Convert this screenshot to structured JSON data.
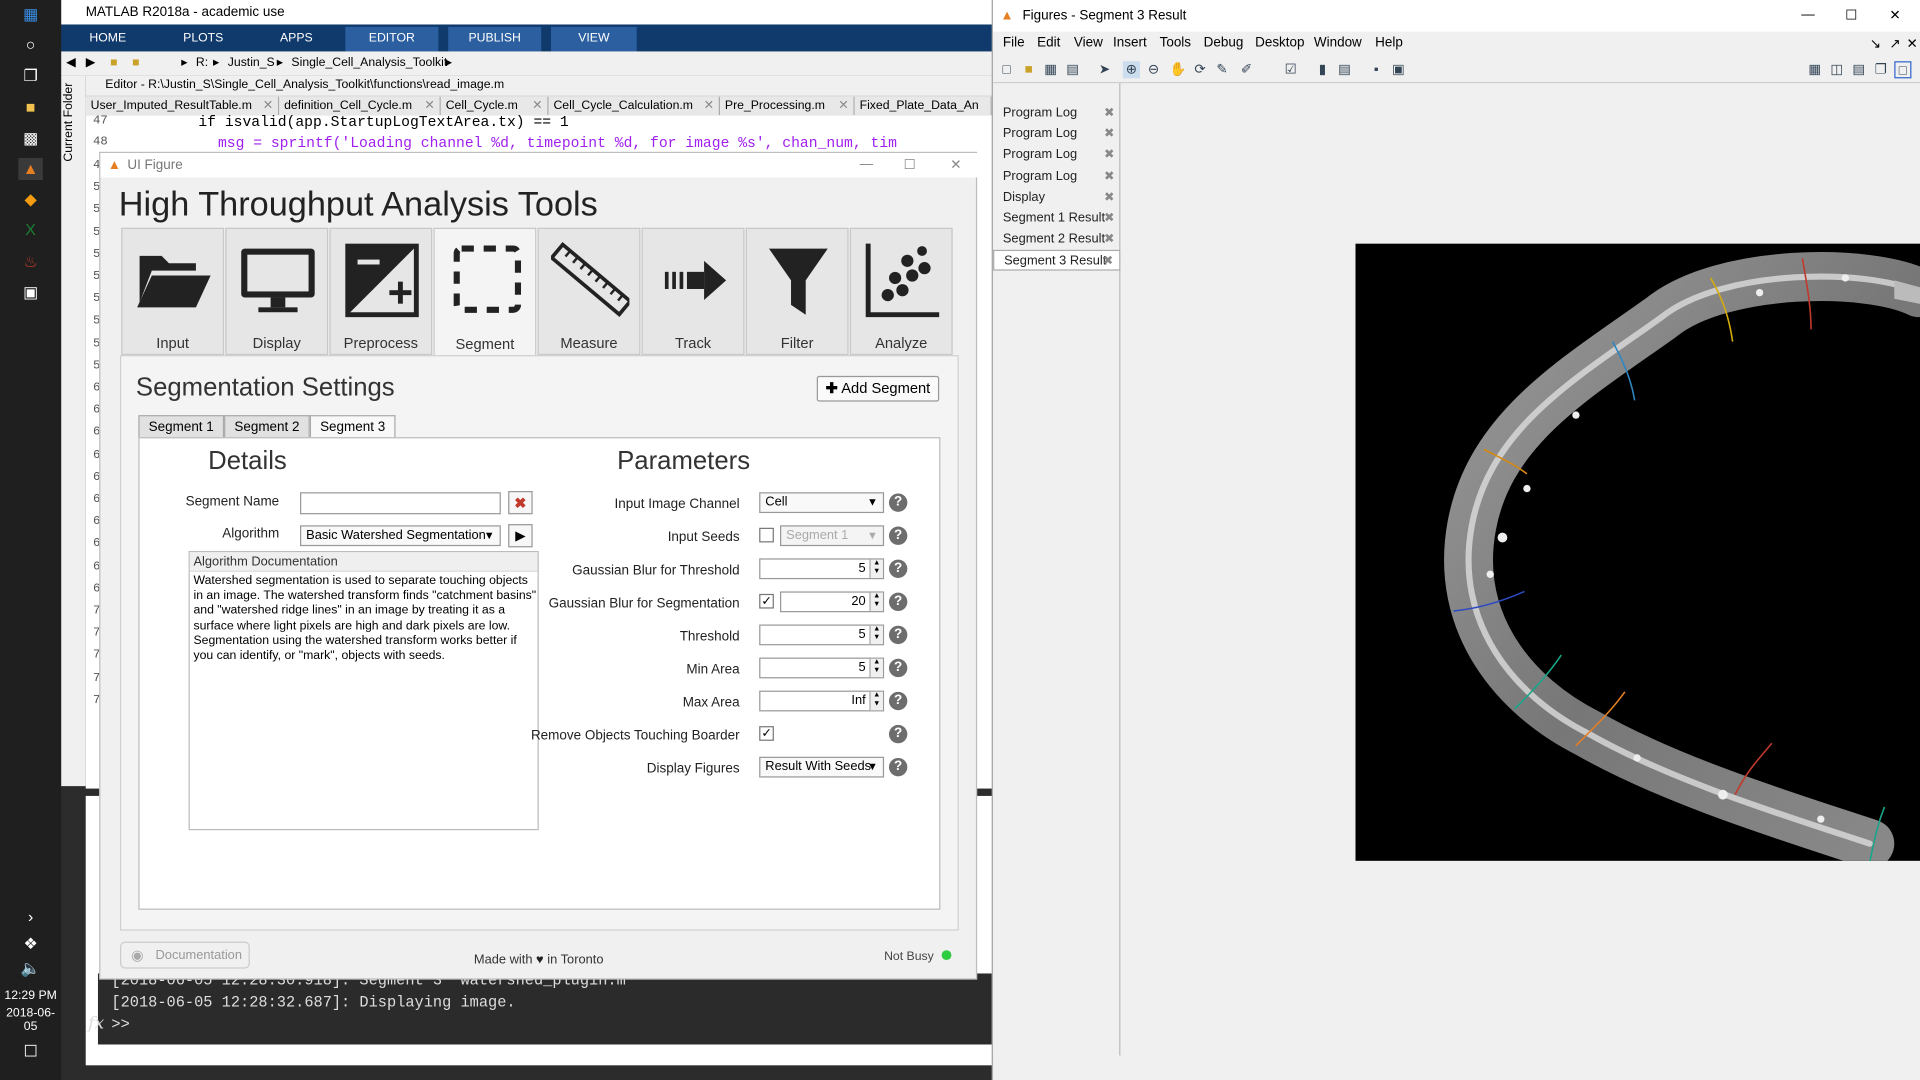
{
  "colors": {
    "accent": "#2b5fa0",
    "ribbon": "#0f3a6b",
    "busy": "#2ecc40",
    "panel": "#f0f0f0"
  },
  "matlab": {
    "title": "MATLAB R2018a - academic use",
    "tabs": [
      "HOME",
      "PLOTS",
      "APPS",
      "EDITOR",
      "PUBLISH",
      "VIEW"
    ],
    "path": [
      "R:",
      "Justin_S",
      "Single_Cell_Analysis_Toolkit"
    ],
    "current_folder_label": "Current Folder",
    "editor_title": "Editor - R:\\Justin_S\\Single_Cell_Analysis_Toolkit\\functions\\read_image.m",
    "file_tabs": [
      "User_Imputed_ResultTable.m",
      "definition_Cell_Cycle.m",
      "Cell_Cycle.m",
      "Cell_Cycle_Calculation.m",
      "Pre_Processing.m",
      "Fixed_Plate_Data_An"
    ],
    "code_lines": [
      {
        "num": "47",
        "text": "if isvalid(app.StartupLogTextArea.tx) == 1"
      },
      {
        "num": "48",
        "text": "msg = sprintf('Loading channel %d, timepoint %d, for image %s', chan_num, tim"
      }
    ],
    "line_numbers": [
      "4",
      "5",
      "5",
      "5",
      "5",
      "5",
      "5",
      "5",
      "5",
      "5",
      "6",
      "6",
      "6",
      "6",
      "6",
      "6",
      "6",
      "6",
      "6",
      "6",
      "7",
      "7",
      "7",
      "7",
      "7"
    ],
    "console_lines": [
      "[2018-06-05 12:28:30.918]: Segment 3 'watershed_plugin.m'",
      "[2018-06-05 12:28:32.687]: Displaying image."
    ],
    "prompt": ">>",
    "fx": "fx"
  },
  "taskbar": {
    "time": "12:29 PM",
    "date": "2018-06-05"
  },
  "ui": {
    "window_title": "UI Figure",
    "app_title": "High Throughput Analysis Tools",
    "tools": [
      "Input",
      "Display",
      "Preprocess",
      "Segment",
      "Measure",
      "Track",
      "Filter",
      "Analyze"
    ],
    "active_tool": "Segment",
    "seg_title": "Segmentation Settings",
    "add_segment": "Add Segment",
    "seg_tabs": [
      "Segment 1",
      "Segment 2",
      "Segment 3"
    ],
    "details": {
      "heading": "Details",
      "segment_name_label": "Segment Name",
      "segment_name_value": "",
      "algorithm_label": "Algorithm",
      "algorithm_value": "Basic Watershed Segmentation",
      "doc_heading": "Algorithm Documentation",
      "doc_text": "Watershed segmentation is used to separate touching objects in an image. The watershed transform finds \"catchment basins\" and \"watershed ridge lines\" in an image by treating it as a surface where light pixels are high and dark pixels are low. Segmentation using the watershed transform works better if you can identify, or \"mark\", objects with seeds."
    },
    "parameters": {
      "heading": "Parameters",
      "items": [
        {
          "label": "Input Image Channel",
          "kind": "select",
          "value": "Cell"
        },
        {
          "label": "Input Seeds",
          "kind": "checkselect",
          "value": "Segment 1",
          "checked": false
        },
        {
          "label": "Gaussian Blur for Threshold",
          "kind": "number",
          "value": "5"
        },
        {
          "label": "Gaussian Blur for Segmentation",
          "kind": "checknumber",
          "value": "20",
          "checked": true
        },
        {
          "label": "Threshold",
          "kind": "number",
          "value": "5"
        },
        {
          "label": "Min Area",
          "kind": "number",
          "value": "5"
        },
        {
          "label": "Max Area",
          "kind": "number",
          "value": "Inf"
        },
        {
          "label": "Remove Objects Touching Boarder",
          "kind": "check",
          "checked": true
        },
        {
          "label": "Display Figures",
          "kind": "select",
          "value": "Result With Seeds"
        }
      ]
    },
    "footer": {
      "documentation": "Documentation",
      "made_with": "Made with",
      "in_toronto": "in Toronto",
      "status": "Not Busy"
    }
  },
  "figures": {
    "title": "Figures - Segment 3 Result",
    "menu": [
      "File",
      "Edit",
      "View",
      "Insert",
      "Tools",
      "Debug",
      "Desktop",
      "Window",
      "Help"
    ],
    "list": [
      "Program Log",
      "Program Log",
      "Program Log",
      "Program Log",
      "Display",
      "Segment 1 Result",
      "Segment 2 Result",
      "Segment 3 Result"
    ],
    "selected": "Segment 3 Result"
  }
}
